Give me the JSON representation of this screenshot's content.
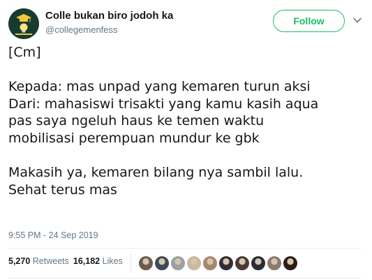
{
  "account": {
    "display_name": "Colle bukan biro jodoh ka",
    "handle": "@collegemenfess",
    "avatar_icon": "graduation-cap-lightbulb-icon"
  },
  "follow_label": "Follow",
  "tweet": {
    "lines": [
      "[Cm]",
      "",
      "Kepada: mas unpad yang kemaren turun aksi",
      "Dari: mahasiswi trisakti yang kamu kasih aqua",
      "pas saya ngeluh haus ke temen waktu",
      "mobilisasi perempuan mundur ke gbk",
      "",
      "Makasih ya, kemaren bilang nya sambil lalu.",
      "Sehat terus mas"
    ]
  },
  "timestamp": "9:55 PM - 24 Sep 2019",
  "stats": {
    "retweets_count": "5,270",
    "retweets_label": "Retweets",
    "likes_count": "16,182",
    "likes_label": "Likes"
  },
  "liker_avatars": [
    "#6b5a4e",
    "#3e4a5a",
    "#9aa0a6",
    "#c9b9a3",
    "#a8866d",
    "#2f2f33",
    "#4b3a36",
    "#2a2d34",
    "#8c7b70",
    "#2b1d18"
  ],
  "colors": {
    "follow_green": "#17bf63",
    "secondary_text": "#657786",
    "primary_text": "#14171a"
  }
}
